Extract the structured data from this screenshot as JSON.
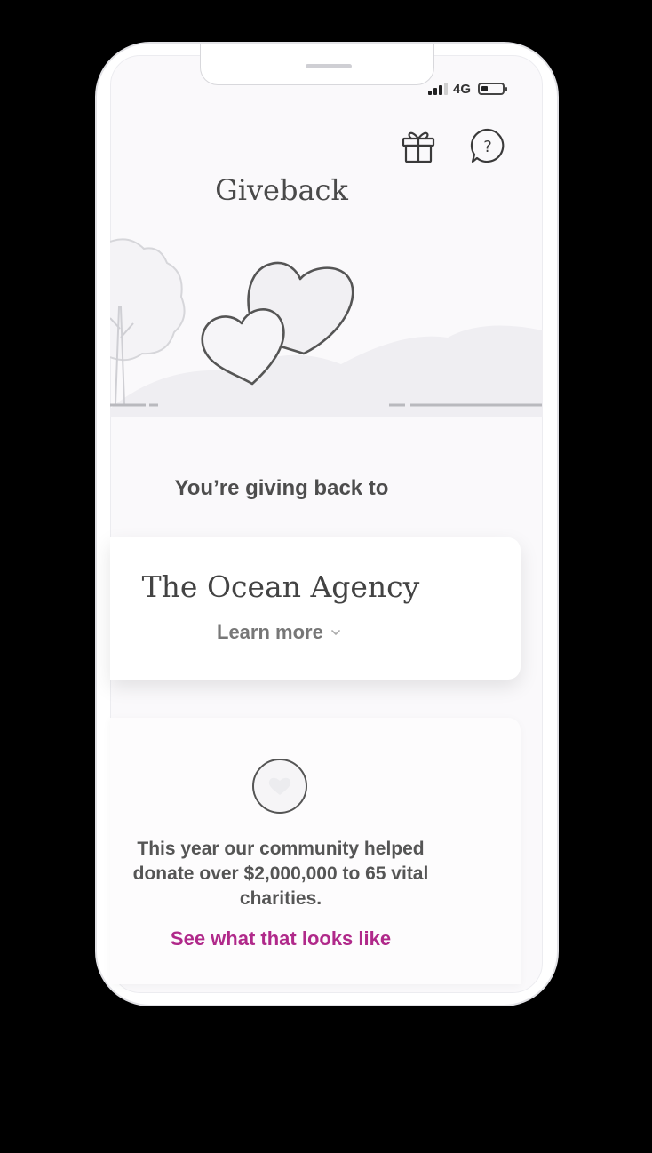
{
  "status_bar": {
    "network": "4G",
    "signal_bars": 3,
    "signal_bars_total": 4
  },
  "header": {
    "title": "Giveback",
    "gift_icon": "gift-icon",
    "help_icon": "help-question-icon",
    "help_glyph": "?"
  },
  "hero": {
    "illustration": "tree-and-hearts-illustration"
  },
  "giving": {
    "label": "You’re giving back to",
    "charity_name": "The Ocean Agency",
    "learn_more": "Learn more"
  },
  "impact": {
    "icon": "heart-icon",
    "text": "This year our community helped donate over $2,000,000 to 65 vital charities.",
    "link": "See what that looks like",
    "link_color": "#b0298a"
  }
}
